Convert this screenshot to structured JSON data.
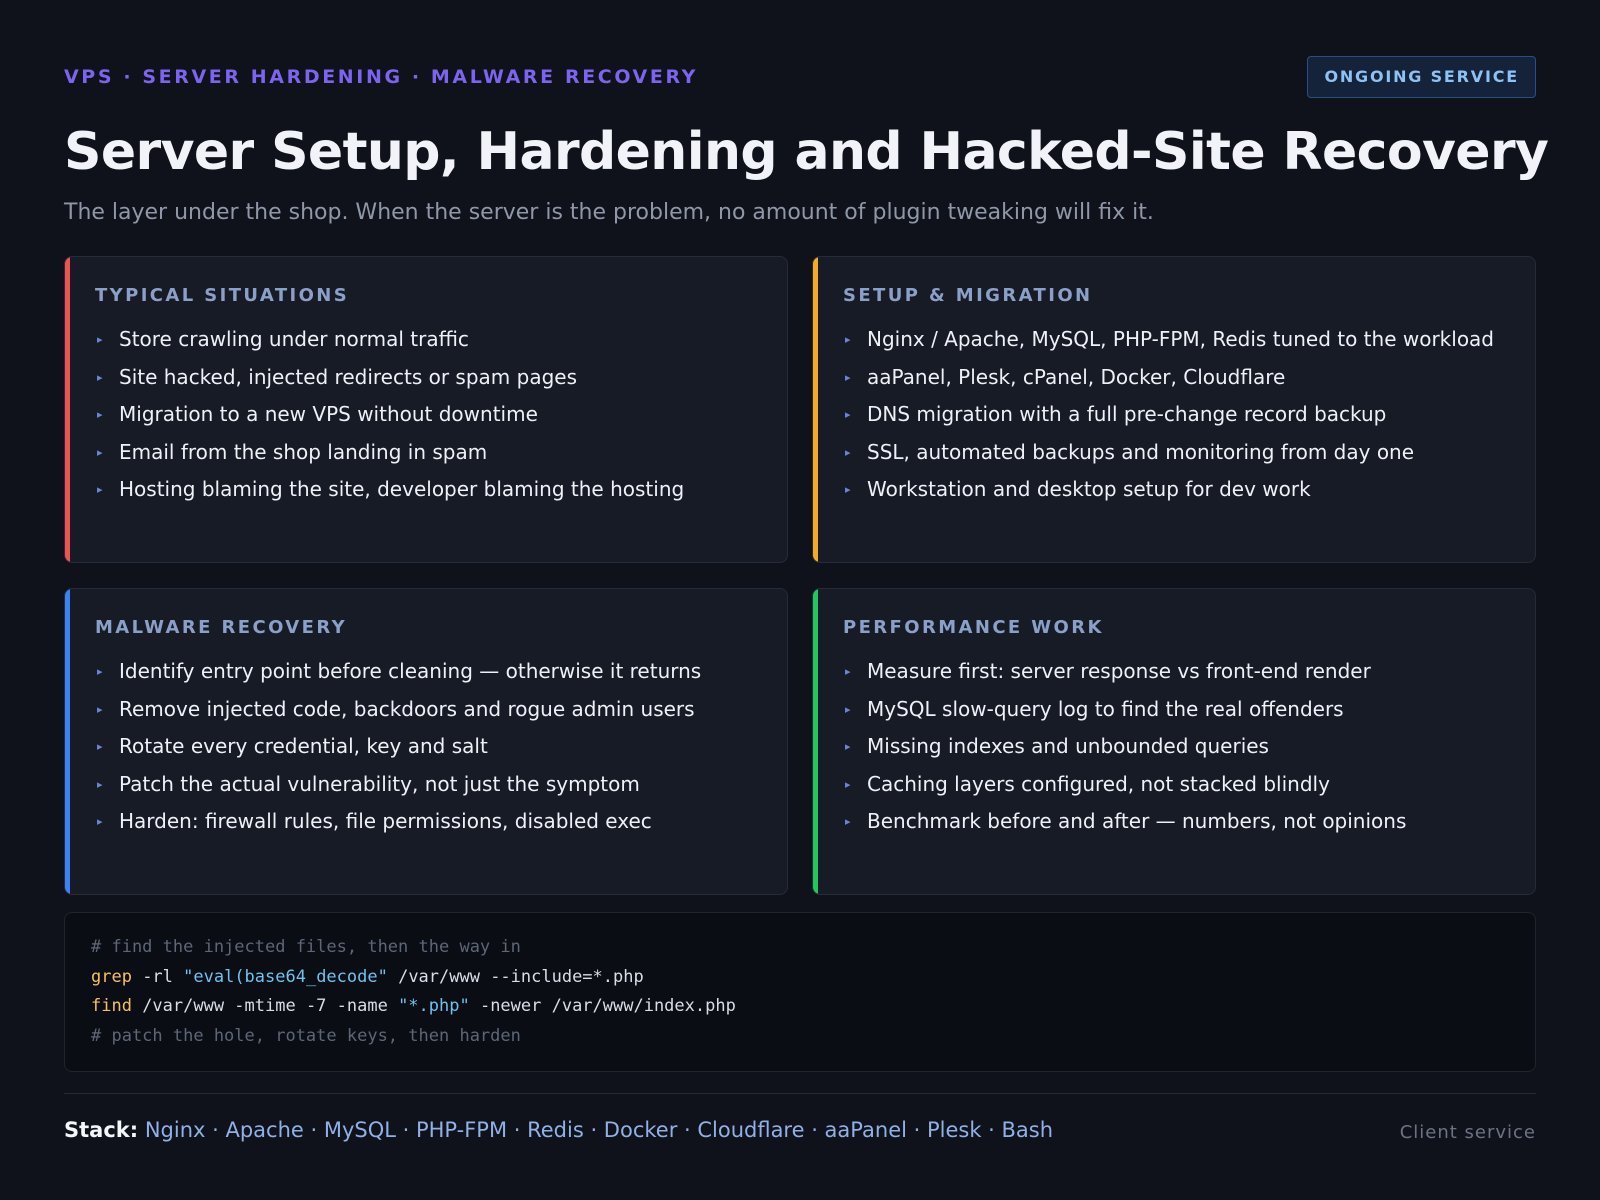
{
  "header": {
    "eyebrow": "VPS · SERVER HARDENING · MALWARE RECOVERY",
    "badge": "ONGOING SERVICE",
    "title": "Server Setup, Hardening and Hacked-Site Recovery",
    "subtitle": "The layer under the shop. When the server is the problem, no amount of plugin tweaking will fix it."
  },
  "cards": [
    {
      "heading": "TYPICAL SITUATIONS",
      "accent": "#ef5350",
      "items": [
        "Store crawling under normal traffic",
        "Site hacked, injected redirects or spam pages",
        "Migration to a new VPS without downtime",
        "Email from the shop landing in spam",
        "Hosting blaming the site, developer blaming the hosting"
      ]
    },
    {
      "heading": "SETUP & MIGRATION",
      "accent": "#f4a927",
      "items": [
        "Nginx / Apache, MySQL, PHP-FPM, Redis tuned to the workload",
        "aaPanel, Plesk, cPanel, Docker, Cloudflare",
        "DNS migration with a full pre-change record backup",
        "SSL, automated backups and monitoring from day one",
        "Workstation and desktop setup for dev work"
      ]
    },
    {
      "heading": "MALWARE RECOVERY",
      "accent": "#3b82f6",
      "items": [
        "Identify entry point before cleaning — otherwise it returns",
        "Remove injected code, backdoors and rogue admin users",
        "Rotate every credential, key and salt",
        "Patch the actual vulnerability, not just the symptom",
        "Harden: firewall rules, file permissions, disabled exec"
      ]
    },
    {
      "heading": "PERFORMANCE WORK",
      "accent": "#22c55e",
      "items": [
        "Measure first: server response vs front-end render",
        "MySQL slow-query log to find the real offenders",
        "Missing indexes and unbounded queries",
        "Caching layers configured, not stacked blindly",
        "Benchmark before and after — numbers, not opinions"
      ]
    }
  ],
  "code": {
    "comment1": "# find the injected files, then the way in",
    "line1_cmd": "grep",
    "line1_a": " -rl ",
    "line1_str": "\"eval(base64_decode\"",
    "line1_b": " /var/www --include=*.php",
    "line2_cmd": "find",
    "line2_a": " /var/www -mtime -7 -name ",
    "line2_str": "\"*.php\"",
    "line2_b": " -newer /var/www/index.php",
    "comment2": "# patch the hole, rotate keys, then harden"
  },
  "footer": {
    "stack_label": "Stack:",
    "stack_items": "Nginx · Apache · MySQL · PHP-FPM · Redis · Docker · Cloudflare · aaPanel · Plesk · Bash",
    "client": "Client service"
  }
}
